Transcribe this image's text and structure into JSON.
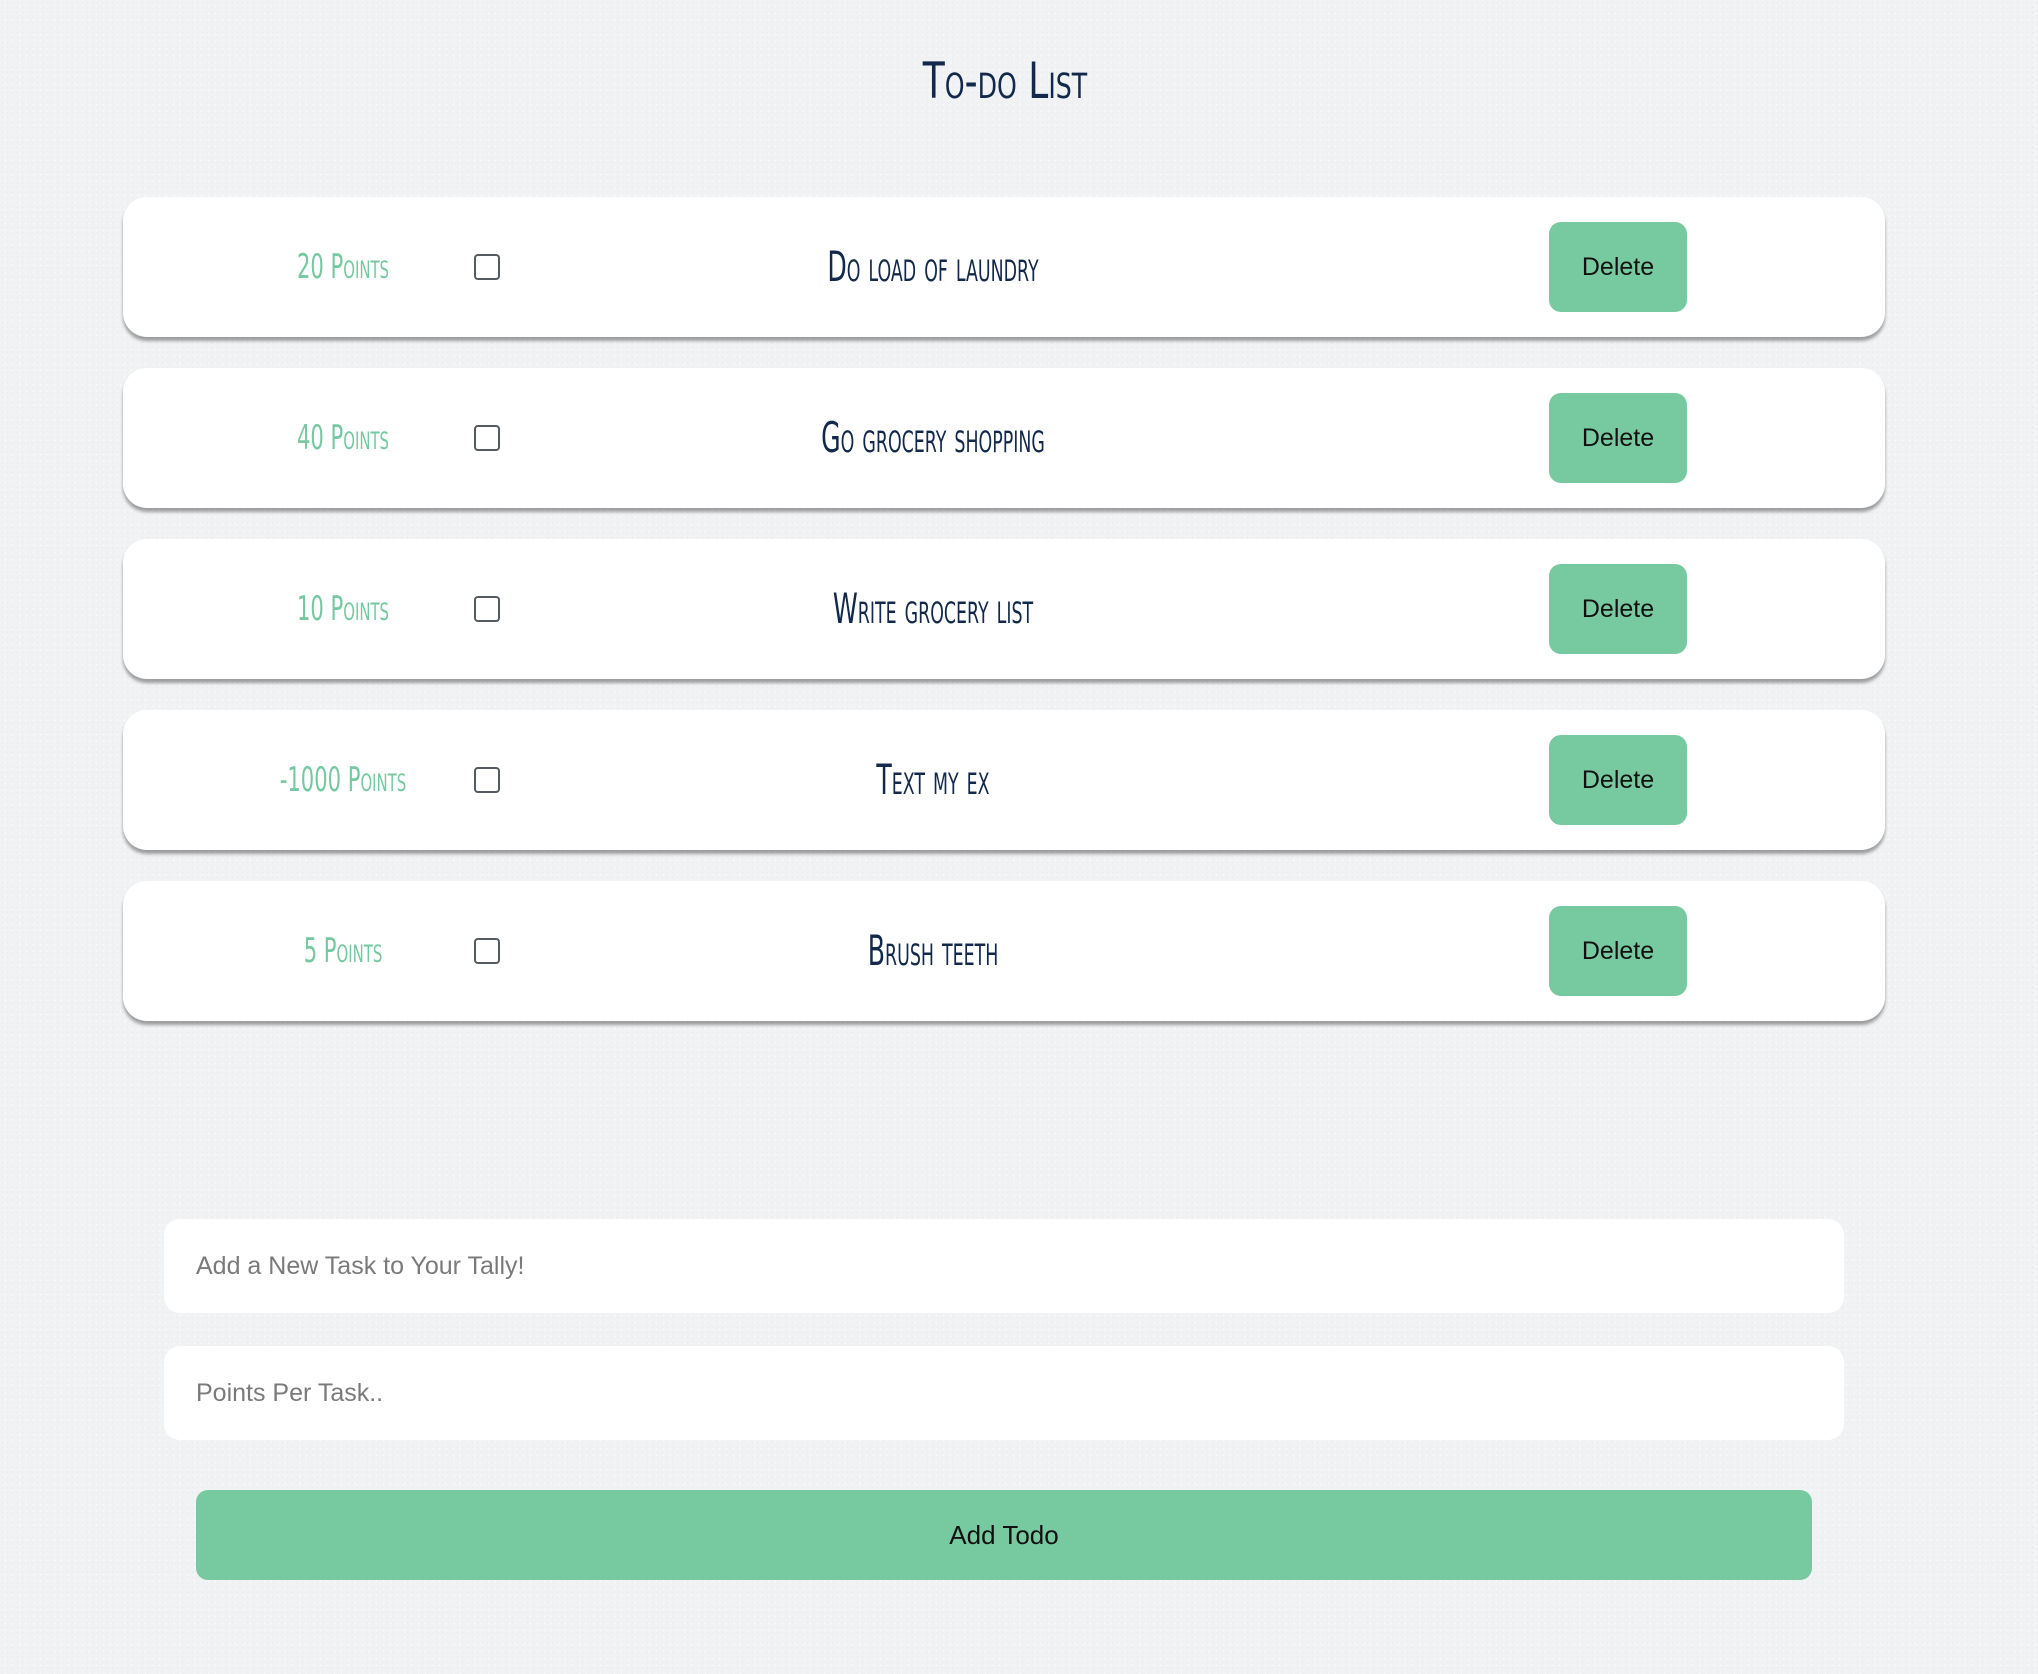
{
  "header": {
    "title": "To-do List"
  },
  "todos": [
    {
      "points": "20 Points",
      "text": "Do load of laundry",
      "done": false,
      "delete_label": "Delete"
    },
    {
      "points": "40 Points",
      "text": "Go grocery shopping",
      "done": false,
      "delete_label": "Delete"
    },
    {
      "points": "10 Points",
      "text": "Write grocery list",
      "done": false,
      "delete_label": "Delete"
    },
    {
      "points": "-1000 Points",
      "text": "Text my ex",
      "done": false,
      "delete_label": "Delete"
    },
    {
      "points": "5 Points",
      "text": "Brush teeth",
      "done": false,
      "delete_label": "Delete"
    }
  ],
  "form": {
    "task_placeholder": "Add a New Task to Your Tally!",
    "task_value": "",
    "points_placeholder": "Points Per Task..",
    "points_value": "",
    "add_label": "Add Todo"
  },
  "colors": {
    "accent": "#77c9a0",
    "heading": "#13294b",
    "background": "#f1f2f4"
  }
}
